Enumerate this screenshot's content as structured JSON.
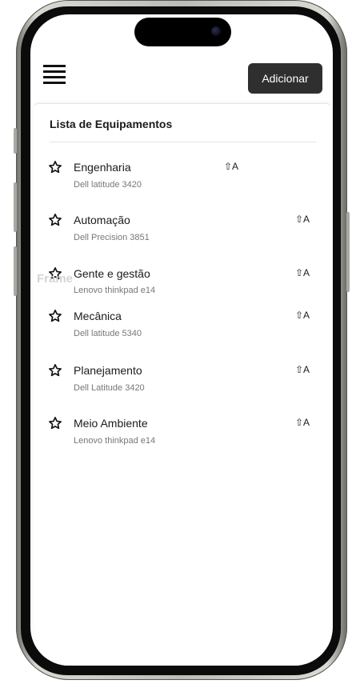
{
  "header": {
    "menu_icon": "hamburger-menu-icon",
    "add_button_label": "Adicionar"
  },
  "list": {
    "title": "Lista de Equipamentos",
    "items": [
      {
        "name": "Engenharia",
        "model": "Dell latitude 3420",
        "shortcut": "⇧A",
        "icon": "star-outline-icon"
      },
      {
        "name": "Automação",
        "model": "Dell Precision 3851",
        "shortcut": "⇧A",
        "icon": "star-outline-icon"
      },
      {
        "name": "Gente e gestão",
        "model": "Lenovo thinkpad e14",
        "shortcut": "⇧A",
        "icon": "star-outline-icon"
      },
      {
        "name": "Mecânica",
        "model": "Dell latitude 5340",
        "shortcut": "⇧A",
        "icon": "star-outline-icon"
      },
      {
        "name": "Planejamento",
        "model": "Dell Latitude 3420",
        "shortcut": "⇧A",
        "icon": "star-outline-icon"
      },
      {
        "name": "Meio Ambiente",
        "model": "Lenovo thinkpad e14",
        "shortcut": "⇧A",
        "icon": "star-outline-icon"
      }
    ]
  },
  "overlay_label": "Frame",
  "colors": {
    "button_bg": "#2f2f2f",
    "button_text": "#ffffff",
    "text_primary": "#1b1b1b",
    "text_secondary": "#777777"
  }
}
